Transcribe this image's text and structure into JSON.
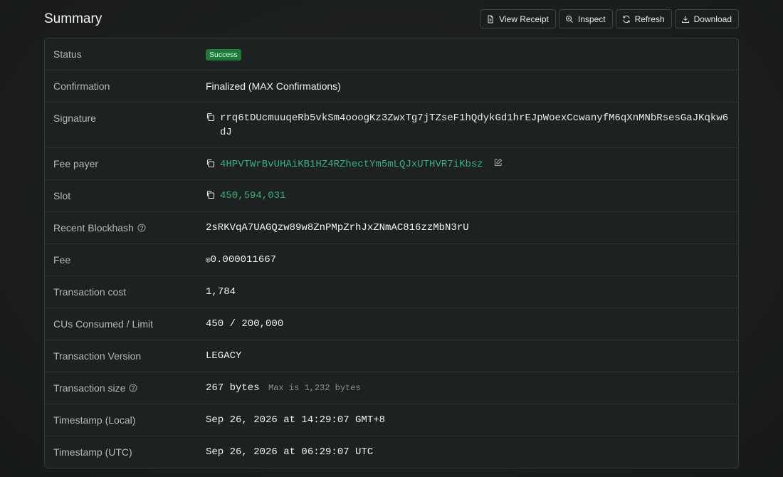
{
  "page": {
    "title": "Summary"
  },
  "toolbar": {
    "view_receipt": "View Receipt",
    "inspect": "Inspect",
    "refresh": "Refresh",
    "download": "Download"
  },
  "rows": {
    "status": {
      "label": "Status",
      "value": "Success"
    },
    "confirmation": {
      "label": "Confirmation",
      "value": "Finalized (MAX Confirmations)"
    },
    "signature": {
      "label": "Signature",
      "value": "rrq6tDUcmuuqeRb5vkSm4ooogKz3ZwxTg7jTZseF1hQdykGd1hrEJpWoexCcwanyfM6qXnMNbRsesGaJKqkw6dJ"
    },
    "fee_payer": {
      "label": "Fee payer",
      "value": "4HPVTWrBvUHAiKB1HZ4RZhectYm5mLQJxUTHVR7iKbsz"
    },
    "slot": {
      "label": "Slot",
      "value": "450,594,031"
    },
    "recent_blockhash": {
      "label": "Recent Blockhash",
      "value": "2sRKVqA7UAGQzw89w8ZnPMpZrhJxZNmAC816zzMbN3rU"
    },
    "fee": {
      "label": "Fee",
      "symbol": "◎",
      "value": "0.000011667"
    },
    "transaction_cost": {
      "label": "Transaction cost",
      "value": "1,784"
    },
    "cus": {
      "label": "CUs Consumed / Limit",
      "value": "450 / 200,000"
    },
    "version": {
      "label": "Transaction Version",
      "value": "LEGACY"
    },
    "size": {
      "label": "Transaction size",
      "value": "267 bytes",
      "note": "Max is 1,232 bytes"
    },
    "timestamp_local": {
      "label": "Timestamp (Local)",
      "value": "Sep 26, 2026 at 14:29:07 GMT+8"
    },
    "timestamp_utc": {
      "label": "Timestamp (UTC)",
      "value": "Sep 26, 2026 at 06:29:07 UTC"
    }
  },
  "colors": {
    "accent_link": "#38b07a",
    "success_badge": "#1f7a3a"
  }
}
